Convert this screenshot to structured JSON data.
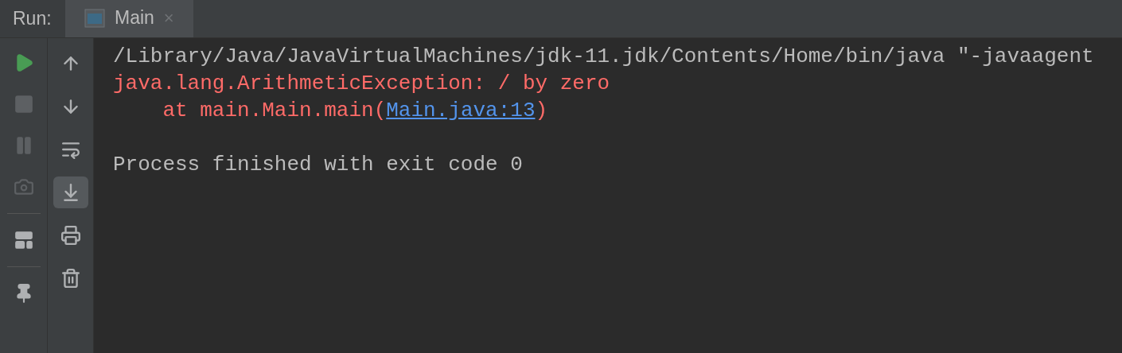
{
  "header": {
    "label": "Run:",
    "tabs": [
      {
        "title": "Main",
        "close": "×",
        "selected": true
      }
    ]
  },
  "left_toolbar": [
    {
      "kind": "run",
      "disabled": false
    },
    {
      "kind": "stop",
      "disabled": true
    },
    {
      "kind": "pause",
      "disabled": true
    },
    {
      "kind": "camera",
      "disabled": true
    },
    {
      "kind": "separator"
    },
    {
      "kind": "layout",
      "disabled": false
    },
    {
      "kind": "separator"
    },
    {
      "kind": "pin",
      "disabled": false
    }
  ],
  "right_toolbar": [
    {
      "kind": "up",
      "selected": false
    },
    {
      "kind": "down",
      "selected": false
    },
    {
      "kind": "wrap",
      "selected": false
    },
    {
      "kind": "scroll_end",
      "selected": true
    },
    {
      "kind": "print",
      "selected": false
    },
    {
      "kind": "trash",
      "selected": false
    }
  ],
  "console": [
    {
      "kind": "plain",
      "text": "/Library/Java/JavaVirtualMachines/jdk-11.jdk/Contents/Home/bin/java \"-javaagent"
    },
    {
      "kind": "error",
      "text": "java.lang.ArithmeticException: / by zero"
    },
    {
      "kind": "error",
      "text": "    at main.Main.main(",
      "link": "Main.java:13",
      "suffix": ")"
    },
    {
      "kind": "blank"
    },
    {
      "kind": "plain",
      "text": "Process finished with exit code 0"
    }
  ]
}
